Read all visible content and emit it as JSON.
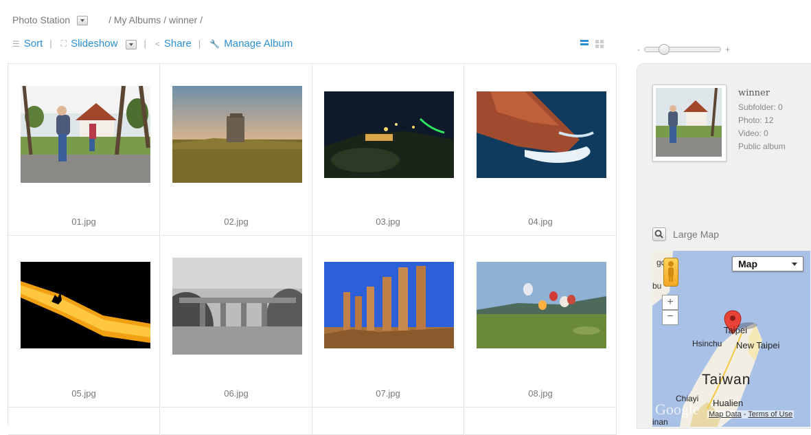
{
  "header": {
    "app_title": "Photo Station",
    "path": "/ My Albums / winner /"
  },
  "toolbar": {
    "sort_label": "Sort",
    "slideshow_label": "Slideshow",
    "share_label": "Share",
    "manage_label": "Manage Album",
    "separator": "|"
  },
  "zoom": {
    "minus": "-",
    "plus": "+",
    "level": 0.15
  },
  "photos": [
    {
      "filename": "01.jpg"
    },
    {
      "filename": "02.jpg"
    },
    {
      "filename": "03.jpg"
    },
    {
      "filename": "04.jpg"
    },
    {
      "filename": "05.jpg"
    },
    {
      "filename": "06.jpg"
    },
    {
      "filename": "07.jpg"
    },
    {
      "filename": "08.jpg"
    }
  ],
  "album": {
    "name": "winner",
    "subfolder": "Subfolder: 0",
    "photo": "Photo: 12",
    "video": "Video: 0",
    "visibility": "Public album"
  },
  "map": {
    "large_map_label": "Large Map",
    "type_label": "Map",
    "zoom_in": "+",
    "zoom_out": "−",
    "places": {
      "taipei": "Taipei",
      "new_taipei": "New Taipei",
      "hsinchu": "Hsinchu",
      "taiwan": "Taiwan",
      "chiayi": "Chiayi",
      "hualien": "Hualien",
      "tainan": "inan",
      "edge_top": "gd",
      "edge_mid": "bu"
    },
    "google": "Google",
    "map_data": "Map Data",
    "dash": "-",
    "terms": "Terms of Use"
  },
  "colors": {
    "link": "#2a8fd6",
    "panel": "#f0f0f0",
    "map_water": "#a9c1e6",
    "land": "#f2eee3"
  }
}
